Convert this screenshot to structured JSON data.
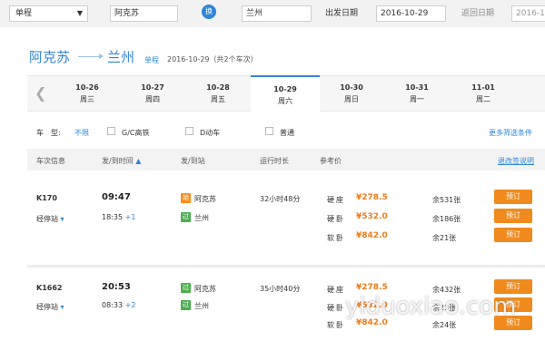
{
  "search": {
    "trip_type": "单程",
    "from": "阿克苏",
    "swap": "换",
    "to": "兰州",
    "depart_label": "出发日期",
    "depart_date": "2016-10-29",
    "return_label": "返回日期",
    "return_date": "2016-1"
  },
  "route": {
    "from": "阿克苏",
    "to": "兰州",
    "trip_type": "单程",
    "info": "2016-10-29（共2个车次）"
  },
  "dates": [
    {
      "date": "10-26",
      "weekday": "周三"
    },
    {
      "date": "10-27",
      "weekday": "周四"
    },
    {
      "date": "10-28",
      "weekday": "周五"
    },
    {
      "date": "10-29",
      "weekday": "周六"
    },
    {
      "date": "10-30",
      "weekday": "周日"
    },
    {
      "date": "10-31",
      "weekday": "周一"
    },
    {
      "date": "11-01",
      "weekday": "周二"
    }
  ],
  "filters": {
    "label": "车　型:",
    "unlimited": "不限",
    "gc": "G/C高铁",
    "d": "D动车",
    "normal": "普通",
    "more": "更多筛选条件"
  },
  "table_head": {
    "info": "车次信息",
    "depart_time": "发/到时间",
    "sort_icon": "▲",
    "station": "发/到站",
    "duration": "运行时长",
    "price": "参考价",
    "refund": "退改签说明"
  },
  "trains": [
    {
      "no": "K170",
      "stops": "经停站",
      "dep": "09:47",
      "arr": "18:35",
      "plus": "+1",
      "from_tag": "始",
      "from": "阿克苏",
      "to_tag": "过",
      "to": "兰州",
      "duration": "32小时48分",
      "seats": [
        {
          "name": "硬座",
          "price": "¥278.5",
          "remain": "余531张",
          "btn": "预订"
        },
        {
          "name": "硬卧",
          "price": "¥532.0",
          "remain": "余186张",
          "btn": "预订"
        },
        {
          "name": "软卧",
          "price": "¥842.0",
          "remain": "余21张",
          "btn": "预订"
        }
      ]
    },
    {
      "no": "K1662",
      "stops": "经停站",
      "dep": "20:53",
      "arr": "08:33",
      "plus": "+2",
      "from_tag": "过",
      "from": "阿克苏",
      "to_tag": "过",
      "to": "兰州",
      "duration": "35小时40分",
      "seats": [
        {
          "name": "硬座",
          "price": "¥278.5",
          "remain": "余432张",
          "btn": "预订"
        },
        {
          "name": "硬卧",
          "price": "¥532.0",
          "remain": "余23张",
          "btn": "预订"
        },
        {
          "name": "软卧",
          "price": "¥842.0",
          "remain": "余24张",
          "btn": "预订"
        }
      ]
    }
  ],
  "watermark": "yiduoxiao.com"
}
